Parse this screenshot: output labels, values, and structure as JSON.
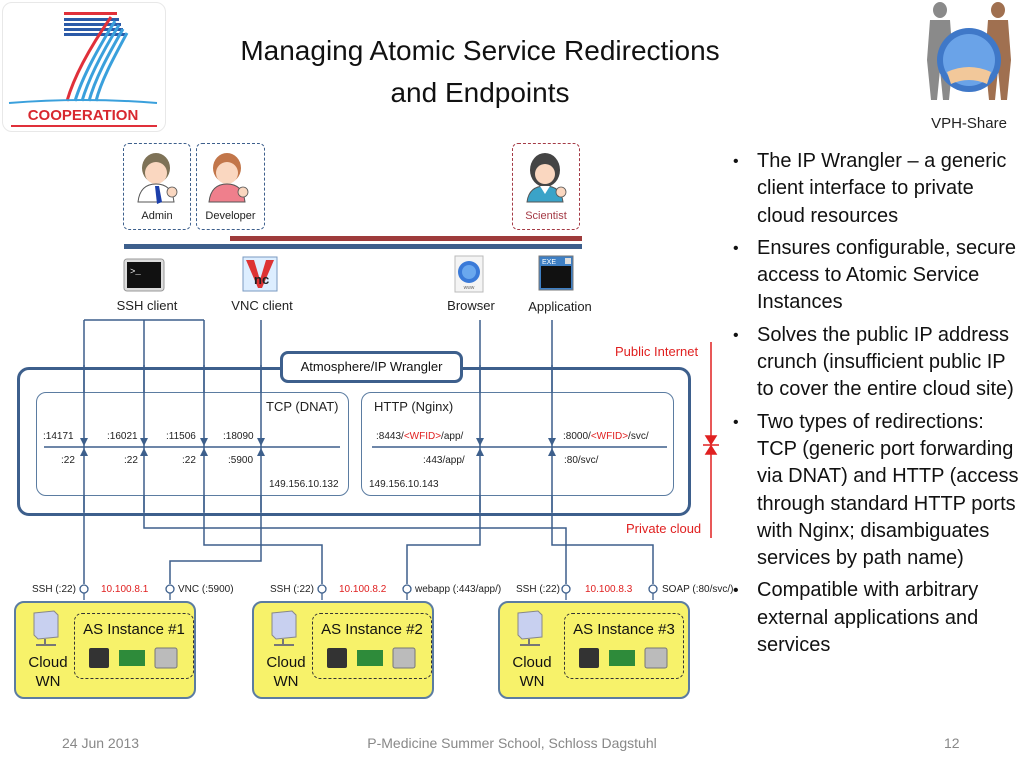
{
  "slide": {
    "title_line1": "Managing Atomic Service Redirections",
    "title_line2": "and Endpoints",
    "logo_left": {
      "text": "COOPERATION",
      "icon": "fp7-logo"
    },
    "logo_right": {
      "text": "VPH-Share",
      "icon": "vph-share-logo"
    }
  },
  "users": [
    {
      "label": "Admin",
      "icon": "admin-user-icon"
    },
    {
      "label": "Developer",
      "icon": "developer-user-icon"
    },
    {
      "label": "Scientist",
      "icon": "scientist-user-icon"
    }
  ],
  "clients": [
    {
      "label": "SSH client",
      "icon": "terminal-icon"
    },
    {
      "label": "VNC client",
      "icon": "vnc-icon"
    },
    {
      "label": "Browser",
      "icon": "globe-www-icon"
    },
    {
      "label": "Application",
      "icon": "exe-window-icon"
    }
  ],
  "zones": {
    "public": "Public Internet",
    "private": "Private cloud"
  },
  "wrangler": {
    "label": "Atmosphere/IP Wrangler",
    "tcp": {
      "title": "TCP (DNAT)",
      "ip": "149.156.10.132",
      "mappings": [
        {
          "public": ":14171",
          "private": ":22"
        },
        {
          "public": ":16021",
          "private": ":22"
        },
        {
          "public": ":11506",
          "private": ":22"
        },
        {
          "public": ":18090",
          "private": ":5900"
        }
      ]
    },
    "http": {
      "title": "HTTP (Nginx)",
      "ip": "149.156.10.143",
      "mappings": [
        {
          "public_prefix": ":8443/",
          "wfid": "<WFID>",
          "public_suffix": "/app/",
          "private": ":443/app/"
        },
        {
          "public_prefix": ":8000/",
          "wfid": "<WFID>",
          "public_suffix": "/svc/",
          "private": ":80/svc/"
        }
      ]
    }
  },
  "instances": [
    {
      "title": "AS Instance #1",
      "ip": "10.100.8.1",
      "left_port": "SSH (:22)",
      "right_port": "VNC (:5900)",
      "node": "Cloud\nWN",
      "node_line1": "Cloud",
      "node_line2": "WN"
    },
    {
      "title": "AS Instance #2",
      "ip": "10.100.8.2",
      "left_port": "SSH (:22)",
      "right_port": "webapp (:443/app/)",
      "node_line1": "Cloud",
      "node_line2": "WN"
    },
    {
      "title": "AS Instance #3",
      "ip": "10.100.8.3",
      "left_port": "SSH (:22)",
      "right_port": "SOAP (:80/svc/)",
      "node_line1": "Cloud",
      "node_line2": "WN"
    }
  ],
  "bullets": [
    "The IP Wrangler – a generic client interface to private cloud resources",
    "Ensures configurable, secure access to Atomic Service Instances",
    "Solves the public IP address crunch (insufficient public IP to cover the entire cloud site)",
    "Two types of redirections: TCP (generic port forwarding via DNAT) and HTTP (access through standard HTTP ports with Nginx; disambiguates services by path name)",
    "Compatible with arbitrary external applications and services"
  ],
  "footer": {
    "date": "24 Jun 2013",
    "event": "P-Medicine Summer School, Schloss Dagstuhl",
    "page": "12"
  },
  "colors": {
    "line_blue": "#3d5f8c",
    "admin_bar_red": "#9e3b3b",
    "highlight_red": "#e02020",
    "wn_yellow": "#f7f26a"
  }
}
